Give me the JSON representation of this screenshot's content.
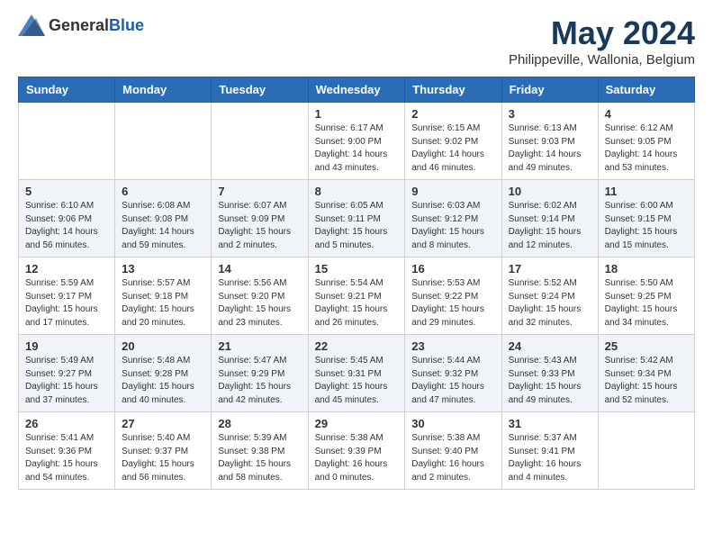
{
  "header": {
    "logo_general": "General",
    "logo_blue": "Blue",
    "month_year": "May 2024",
    "location": "Philippeville, Wallonia, Belgium"
  },
  "weekdays": [
    "Sunday",
    "Monday",
    "Tuesday",
    "Wednesday",
    "Thursday",
    "Friday",
    "Saturday"
  ],
  "weeks": [
    [
      null,
      null,
      null,
      {
        "day": "1",
        "sunrise": "Sunrise: 6:17 AM",
        "sunset": "Sunset: 9:00 PM",
        "daylight": "Daylight: 14 hours and 43 minutes."
      },
      {
        "day": "2",
        "sunrise": "Sunrise: 6:15 AM",
        "sunset": "Sunset: 9:02 PM",
        "daylight": "Daylight: 14 hours and 46 minutes."
      },
      {
        "day": "3",
        "sunrise": "Sunrise: 6:13 AM",
        "sunset": "Sunset: 9:03 PM",
        "daylight": "Daylight: 14 hours and 49 minutes."
      },
      {
        "day": "4",
        "sunrise": "Sunrise: 6:12 AM",
        "sunset": "Sunset: 9:05 PM",
        "daylight": "Daylight: 14 hours and 53 minutes."
      }
    ],
    [
      {
        "day": "5",
        "sunrise": "Sunrise: 6:10 AM",
        "sunset": "Sunset: 9:06 PM",
        "daylight": "Daylight: 14 hours and 56 minutes."
      },
      {
        "day": "6",
        "sunrise": "Sunrise: 6:08 AM",
        "sunset": "Sunset: 9:08 PM",
        "daylight": "Daylight: 14 hours and 59 minutes."
      },
      {
        "day": "7",
        "sunrise": "Sunrise: 6:07 AM",
        "sunset": "Sunset: 9:09 PM",
        "daylight": "Daylight: 15 hours and 2 minutes."
      },
      {
        "day": "8",
        "sunrise": "Sunrise: 6:05 AM",
        "sunset": "Sunset: 9:11 PM",
        "daylight": "Daylight: 15 hours and 5 minutes."
      },
      {
        "day": "9",
        "sunrise": "Sunrise: 6:03 AM",
        "sunset": "Sunset: 9:12 PM",
        "daylight": "Daylight: 15 hours and 8 minutes."
      },
      {
        "day": "10",
        "sunrise": "Sunrise: 6:02 AM",
        "sunset": "Sunset: 9:14 PM",
        "daylight": "Daylight: 15 hours and 12 minutes."
      },
      {
        "day": "11",
        "sunrise": "Sunrise: 6:00 AM",
        "sunset": "Sunset: 9:15 PM",
        "daylight": "Daylight: 15 hours and 15 minutes."
      }
    ],
    [
      {
        "day": "12",
        "sunrise": "Sunrise: 5:59 AM",
        "sunset": "Sunset: 9:17 PM",
        "daylight": "Daylight: 15 hours and 17 minutes."
      },
      {
        "day": "13",
        "sunrise": "Sunrise: 5:57 AM",
        "sunset": "Sunset: 9:18 PM",
        "daylight": "Daylight: 15 hours and 20 minutes."
      },
      {
        "day": "14",
        "sunrise": "Sunrise: 5:56 AM",
        "sunset": "Sunset: 9:20 PM",
        "daylight": "Daylight: 15 hours and 23 minutes."
      },
      {
        "day": "15",
        "sunrise": "Sunrise: 5:54 AM",
        "sunset": "Sunset: 9:21 PM",
        "daylight": "Daylight: 15 hours and 26 minutes."
      },
      {
        "day": "16",
        "sunrise": "Sunrise: 5:53 AM",
        "sunset": "Sunset: 9:22 PM",
        "daylight": "Daylight: 15 hours and 29 minutes."
      },
      {
        "day": "17",
        "sunrise": "Sunrise: 5:52 AM",
        "sunset": "Sunset: 9:24 PM",
        "daylight": "Daylight: 15 hours and 32 minutes."
      },
      {
        "day": "18",
        "sunrise": "Sunrise: 5:50 AM",
        "sunset": "Sunset: 9:25 PM",
        "daylight": "Daylight: 15 hours and 34 minutes."
      }
    ],
    [
      {
        "day": "19",
        "sunrise": "Sunrise: 5:49 AM",
        "sunset": "Sunset: 9:27 PM",
        "daylight": "Daylight: 15 hours and 37 minutes."
      },
      {
        "day": "20",
        "sunrise": "Sunrise: 5:48 AM",
        "sunset": "Sunset: 9:28 PM",
        "daylight": "Daylight: 15 hours and 40 minutes."
      },
      {
        "day": "21",
        "sunrise": "Sunrise: 5:47 AM",
        "sunset": "Sunset: 9:29 PM",
        "daylight": "Daylight: 15 hours and 42 minutes."
      },
      {
        "day": "22",
        "sunrise": "Sunrise: 5:45 AM",
        "sunset": "Sunset: 9:31 PM",
        "daylight": "Daylight: 15 hours and 45 minutes."
      },
      {
        "day": "23",
        "sunrise": "Sunrise: 5:44 AM",
        "sunset": "Sunset: 9:32 PM",
        "daylight": "Daylight: 15 hours and 47 minutes."
      },
      {
        "day": "24",
        "sunrise": "Sunrise: 5:43 AM",
        "sunset": "Sunset: 9:33 PM",
        "daylight": "Daylight: 15 hours and 49 minutes."
      },
      {
        "day": "25",
        "sunrise": "Sunrise: 5:42 AM",
        "sunset": "Sunset: 9:34 PM",
        "daylight": "Daylight: 15 hours and 52 minutes."
      }
    ],
    [
      {
        "day": "26",
        "sunrise": "Sunrise: 5:41 AM",
        "sunset": "Sunset: 9:36 PM",
        "daylight": "Daylight: 15 hours and 54 minutes."
      },
      {
        "day": "27",
        "sunrise": "Sunrise: 5:40 AM",
        "sunset": "Sunset: 9:37 PM",
        "daylight": "Daylight: 15 hours and 56 minutes."
      },
      {
        "day": "28",
        "sunrise": "Sunrise: 5:39 AM",
        "sunset": "Sunset: 9:38 PM",
        "daylight": "Daylight: 15 hours and 58 minutes."
      },
      {
        "day": "29",
        "sunrise": "Sunrise: 5:38 AM",
        "sunset": "Sunset: 9:39 PM",
        "daylight": "Daylight: 16 hours and 0 minutes."
      },
      {
        "day": "30",
        "sunrise": "Sunrise: 5:38 AM",
        "sunset": "Sunset: 9:40 PM",
        "daylight": "Daylight: 16 hours and 2 minutes."
      },
      {
        "day": "31",
        "sunrise": "Sunrise: 5:37 AM",
        "sunset": "Sunset: 9:41 PM",
        "daylight": "Daylight: 16 hours and 4 minutes."
      },
      null
    ]
  ]
}
